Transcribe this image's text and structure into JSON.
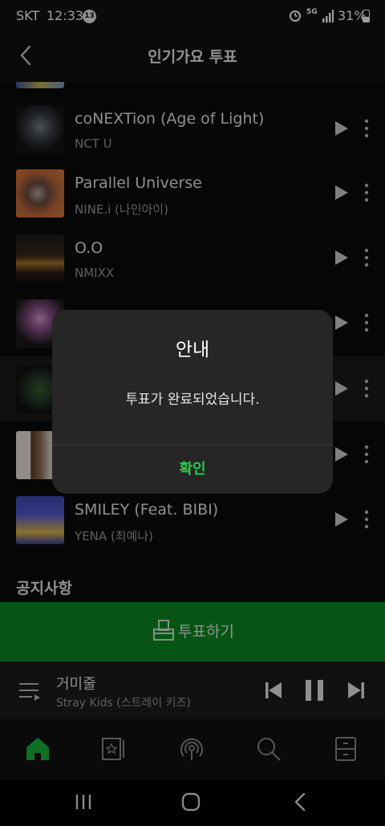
{
  "status_bar": {
    "carrier": "SKT",
    "time": "12:33",
    "notification_count": "13",
    "network": "5G",
    "battery": "31%"
  },
  "header": {
    "title": "인기가요 투표",
    "back_icon": "chevron-left-icon"
  },
  "songs": [
    {
      "title": "coNEXTion (Age of Light)",
      "artist": "NCT U"
    },
    {
      "title": "Parallel Universe",
      "artist": "NINE.i (나인아이)"
    },
    {
      "title": "O.O",
      "artist": "NMIXX"
    },
    {
      "title": "",
      "artist": ""
    },
    {
      "title": "",
      "artist": ""
    },
    {
      "title": "",
      "artist": ""
    },
    {
      "title": "SMILEY (Feat. BIBI)",
      "artist": "YENA (최예나)"
    }
  ],
  "notice_heading": "공지사항",
  "vote_button_label": "투표하기",
  "now_playing": {
    "title": "거미줄",
    "artist": "Stray Kids (스트레이 키즈)"
  },
  "bottom_nav": [
    "home-icon",
    "library-icon",
    "podcast-icon",
    "search-icon",
    "drawer-icon"
  ],
  "dialog": {
    "title": "안내",
    "message": "투표가 완료되었습니다.",
    "confirm_label": "확인"
  },
  "colors": {
    "accent_green": "#1ed04a",
    "vote_bar": "#0c8a22",
    "background": "#0a0a0a"
  }
}
